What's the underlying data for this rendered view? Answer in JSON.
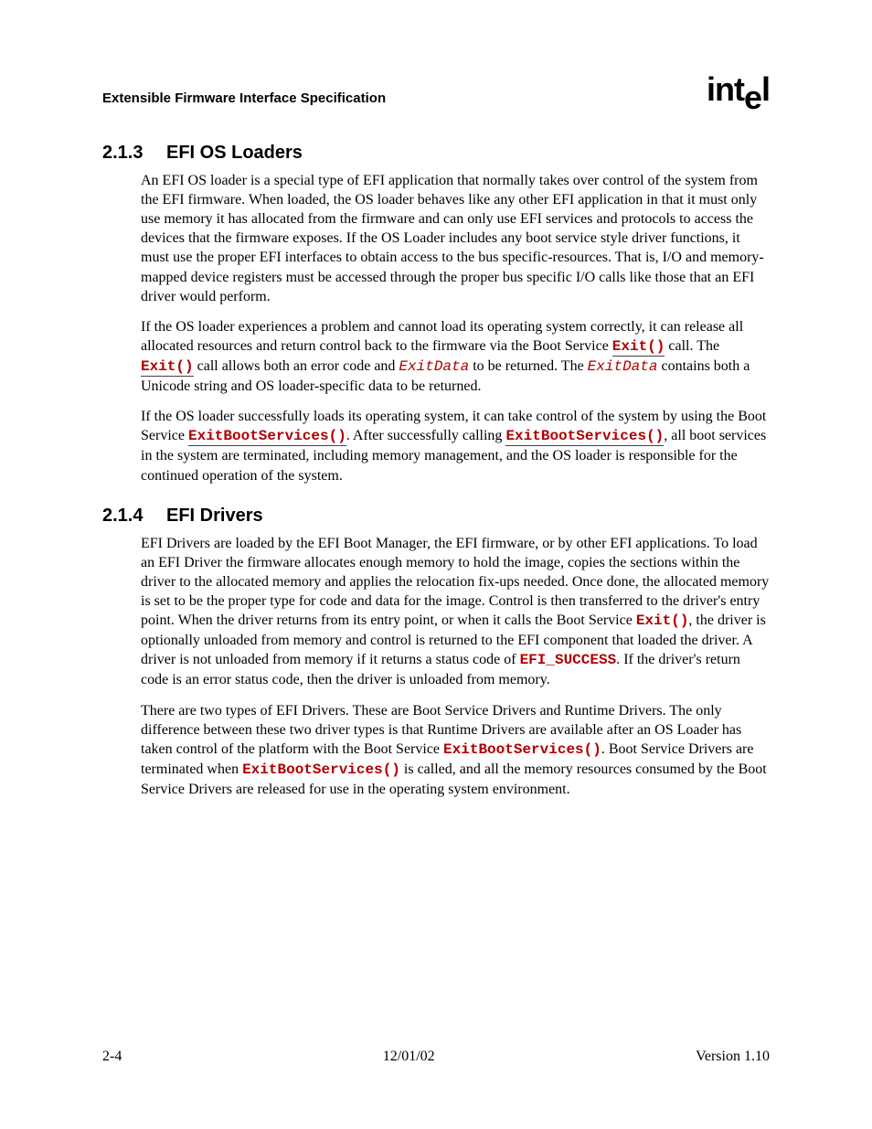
{
  "header": {
    "doc_title": "Extensible Firmware Interface Specification",
    "logo_text_1": "int",
    "logo_text_2": "e",
    "logo_text_3": "l"
  },
  "sections": {
    "s213": {
      "num": "2.1.3",
      "title": "EFI OS Loaders",
      "p1_a": "An EFI OS loader is a special type of EFI application that normally takes over control of the system from the EFI firmware.  When loaded, the OS loader behaves like any other EFI application in that it must only use memory it has allocated from the firmware and can only use EFI services and protocols to access the devices that the firmware exposes.  If the OS Loader includes any boot service style driver functions, it must use the proper EFI interfaces to obtain access to the bus specific-resources.  That is, I/O and memory-mapped device registers must be accessed through the proper bus specific I/O calls like those that an EFI driver would perform.",
      "p2_a": "If the OS loader experiences a problem and cannot load its operating system correctly, it can release all allocated resources and return control back to the firmware via the Boot Service ",
      "p2_b": " call.  The ",
      "p2_c": " call allows both an error code and ",
      "p2_d": " to be returned.  The ",
      "p2_e": " contains both a Unicode string and OS loader-specific data to be returned.",
      "p3_a": "If the OS loader successfully loads its operating system, it can take control of the system by using the Boot Service ",
      "p3_b": ".  After successfully calling ",
      "p3_c": ", all boot services in the system are terminated, including memory management, and the OS loader is responsible for the continued operation of the system."
    },
    "s214": {
      "num": "2.1.4",
      "title": "EFI Drivers",
      "p1_a": "EFI Drivers are loaded by the EFI Boot Manager, the EFI firmware, or by other EFI applications.  To load an EFI Driver the firmware allocates enough memory to hold the image, copies the sections within the driver to the allocated memory and applies the relocation fix-ups needed.  Once done, the allocated memory is set to be the proper type for code and data for the image.  Control is then transferred to the driver's entry point.  When the driver returns from its entry point, or when it calls the Boot Service ",
      "p1_b": ", the driver is optionally unloaded from memory and control is returned to the EFI component that loaded the driver.  A driver is not unloaded from memory if it returns a status code of ",
      "p1_c": ".  If the driver's return code is an error status code, then the driver is unloaded from memory.",
      "p2_a": "There are two types of EFI Drivers.  These are Boot Service Drivers and Runtime Drivers.  The only difference between these two driver types is that Runtime Drivers are available after an OS Loader has taken control of the platform with the Boot Service ",
      "p2_b": ".  Boot Service Drivers are terminated when ",
      "p2_c": " is called, and all the memory resources consumed by the Boot Service Drivers are released for use in the operating system environment."
    }
  },
  "codes": {
    "exit": "Exit()",
    "exitdata": "ExitData",
    "exitboot": "ExitBootServices()",
    "efisuccess": "EFI_SUCCESS"
  },
  "footer": {
    "left": "2-4",
    "center": "12/01/02",
    "right": "Version 1.10"
  }
}
